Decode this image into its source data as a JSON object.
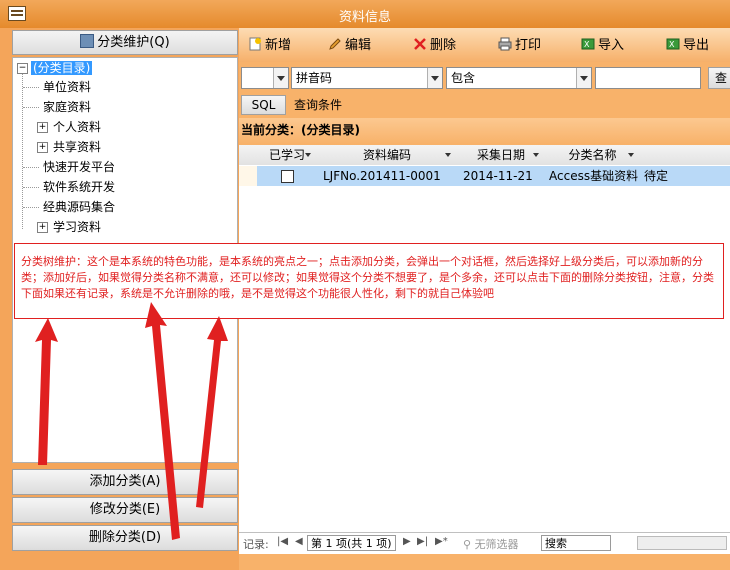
{
  "window": {
    "title": "资料信息"
  },
  "left": {
    "header_button": "分类维护(Q)",
    "tree": {
      "root": "(分类目录)",
      "items": [
        "单位资料",
        "家庭资料",
        "个人资料",
        "共享资料",
        "快速开发平台",
        "软件系统开发",
        "经典源码集合",
        "学习资料"
      ]
    },
    "buttons": {
      "add": "添加分类(A)",
      "edit": "修改分类(E)",
      "delete": "删除分类(D)"
    }
  },
  "toolbar": {
    "new": "新增",
    "edit": "编辑",
    "delete": "删除",
    "print": "打印",
    "import": "导入",
    "export": "导出"
  },
  "search": {
    "field": "拼音码",
    "operator": "包含",
    "query_button_partial": "查",
    "sql_button": "SQL",
    "condition_label": "查询条件"
  },
  "category": {
    "current_label": "当前分类：(分类目录)"
  },
  "grid": {
    "columns": [
      "已学习",
      "资料编码",
      "采集日期",
      "分类名称"
    ],
    "rows": [
      {
        "code": "LJFNo.201411-0001",
        "date": "2014-11-21",
        "category": "Access基础资料",
        "status": "待定"
      }
    ]
  },
  "status": {
    "label": "记录:",
    "page": "第 1 项(共 1 项)",
    "filter": "无筛选器",
    "search": "搜索"
  },
  "annotation": {
    "text": "分类树维护：这个是本系统的特色功能，是本系统的亮点之一；点击添加分类，会弹出一个对话框，然后选择好上级分类后，可以添加新的分类；添加好后，如果觉得分类名称不满意，还可以修改；如果觉得这个分类不想要了，是个多余，还可以点击下面的删除分类按钮，注意，分类下面如果还有记录，系统是不允许删除的哦，是不是觉得这个功能很人性化，剩下的就自己体验吧"
  },
  "colors": {
    "accent": "#f4a55a",
    "selection": "#b9d9f7",
    "annotation": "#e02020"
  }
}
